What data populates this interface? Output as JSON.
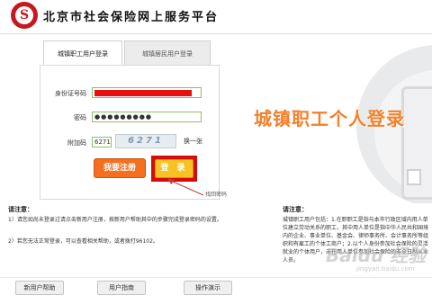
{
  "header": {
    "logo_letter": "S",
    "title": "北京市社会保险网上服务平台"
  },
  "tabs": [
    {
      "label": "城镇职工用户登录",
      "active": true
    },
    {
      "label": "城镇居民用户登录",
      "active": false
    }
  ],
  "form": {
    "id_label": "身份证号码",
    "password_label": "密码",
    "password_value": "●●●●●●●●●",
    "captcha_label": "附加码",
    "captcha_value": "6271",
    "captcha_image_text": "6271",
    "refresh_label": "换一张",
    "register_label": "我要注册",
    "login_label": "登 录",
    "forgot_label": "找回密码"
  },
  "banner": {
    "title": "城镇职工个人登录"
  },
  "notice_left": {
    "title": "请注意：",
    "item1": "1）请您如尚未登录过请点击新用户注册，按新用户帮助其中的步骤完成登录密码的设置。",
    "item2": "2）若您无法正常登录，可以查看相关帮助，或者拨打96102。"
  },
  "notice_right": {
    "title": "请注意：",
    "text": "城镇职工用户包括：1.在职职工是指与本市行政区域内用人单位建立劳动关系的职工，其中用人单位是指中华人民共和国境内的企业、事业单位、基金会、律师事务所、会计事务所等组织和有雇工的个体工商户；2.以个人身份参加社会保险的灵活就业的个体用户，未在用人单位参加社会保险的非全日制从业人员。"
  },
  "bottom_buttons": [
    {
      "label": "新用户帮助"
    },
    {
      "label": "用户指南"
    },
    {
      "label": "操作演示"
    }
  ],
  "watermark": {
    "brand": "Baidu 经验",
    "url": "jingyan.baidu.com"
  },
  "colors": {
    "brand_red": "#c8171d",
    "highlight_red": "#e50f0f",
    "register_orange": "#f46f1e",
    "login_yellow": "#f7c324",
    "banner_orange": "#f4802b",
    "field_border_green": "#8fbf64"
  }
}
